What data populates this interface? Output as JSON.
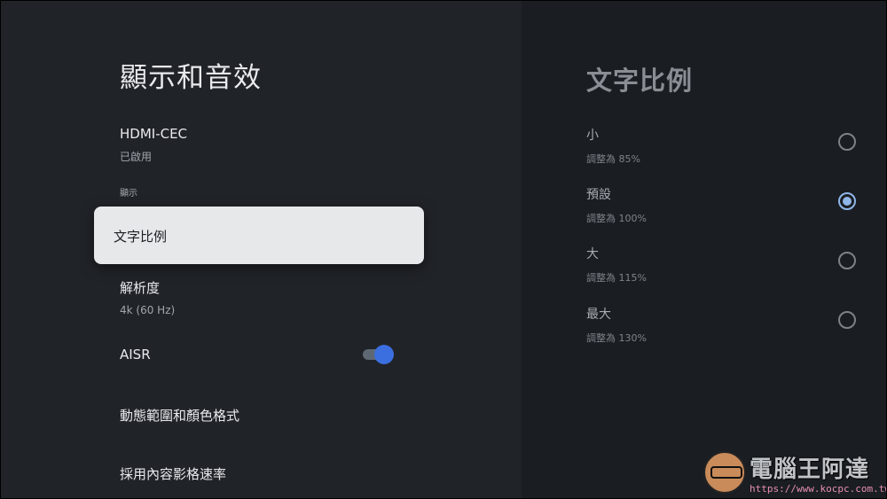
{
  "left": {
    "title": "顯示和音效",
    "items": {
      "hdmi": {
        "title": "HDMI-CEC",
        "sub": "已啟用"
      },
      "section_label": "顯示",
      "focused": "文字比例",
      "resolution": {
        "title": "解析度",
        "sub": "4k (60 Hz)"
      },
      "aisr": {
        "title": "AISR",
        "toggle": "on"
      },
      "dynamic": "動態範圍和顏色格式",
      "framerate": "採用內容影格速率"
    }
  },
  "right": {
    "title": "文字比例",
    "options": [
      {
        "title": "小",
        "sub": "調整為 85%",
        "selected": false
      },
      {
        "title": "預設",
        "sub": "調整為 100%",
        "selected": true
      },
      {
        "title": "大",
        "sub": "調整為 115%",
        "selected": false
      },
      {
        "title": "最大",
        "sub": "調整為 130%",
        "selected": false
      }
    ]
  },
  "watermark": {
    "name": "電腦王阿達",
    "url": "https://www.kocpc.com.tw/"
  },
  "colors": {
    "accent": "#3b6fe0",
    "radio_checked": "#8fb6e8",
    "card": "#e6e8ea"
  }
}
